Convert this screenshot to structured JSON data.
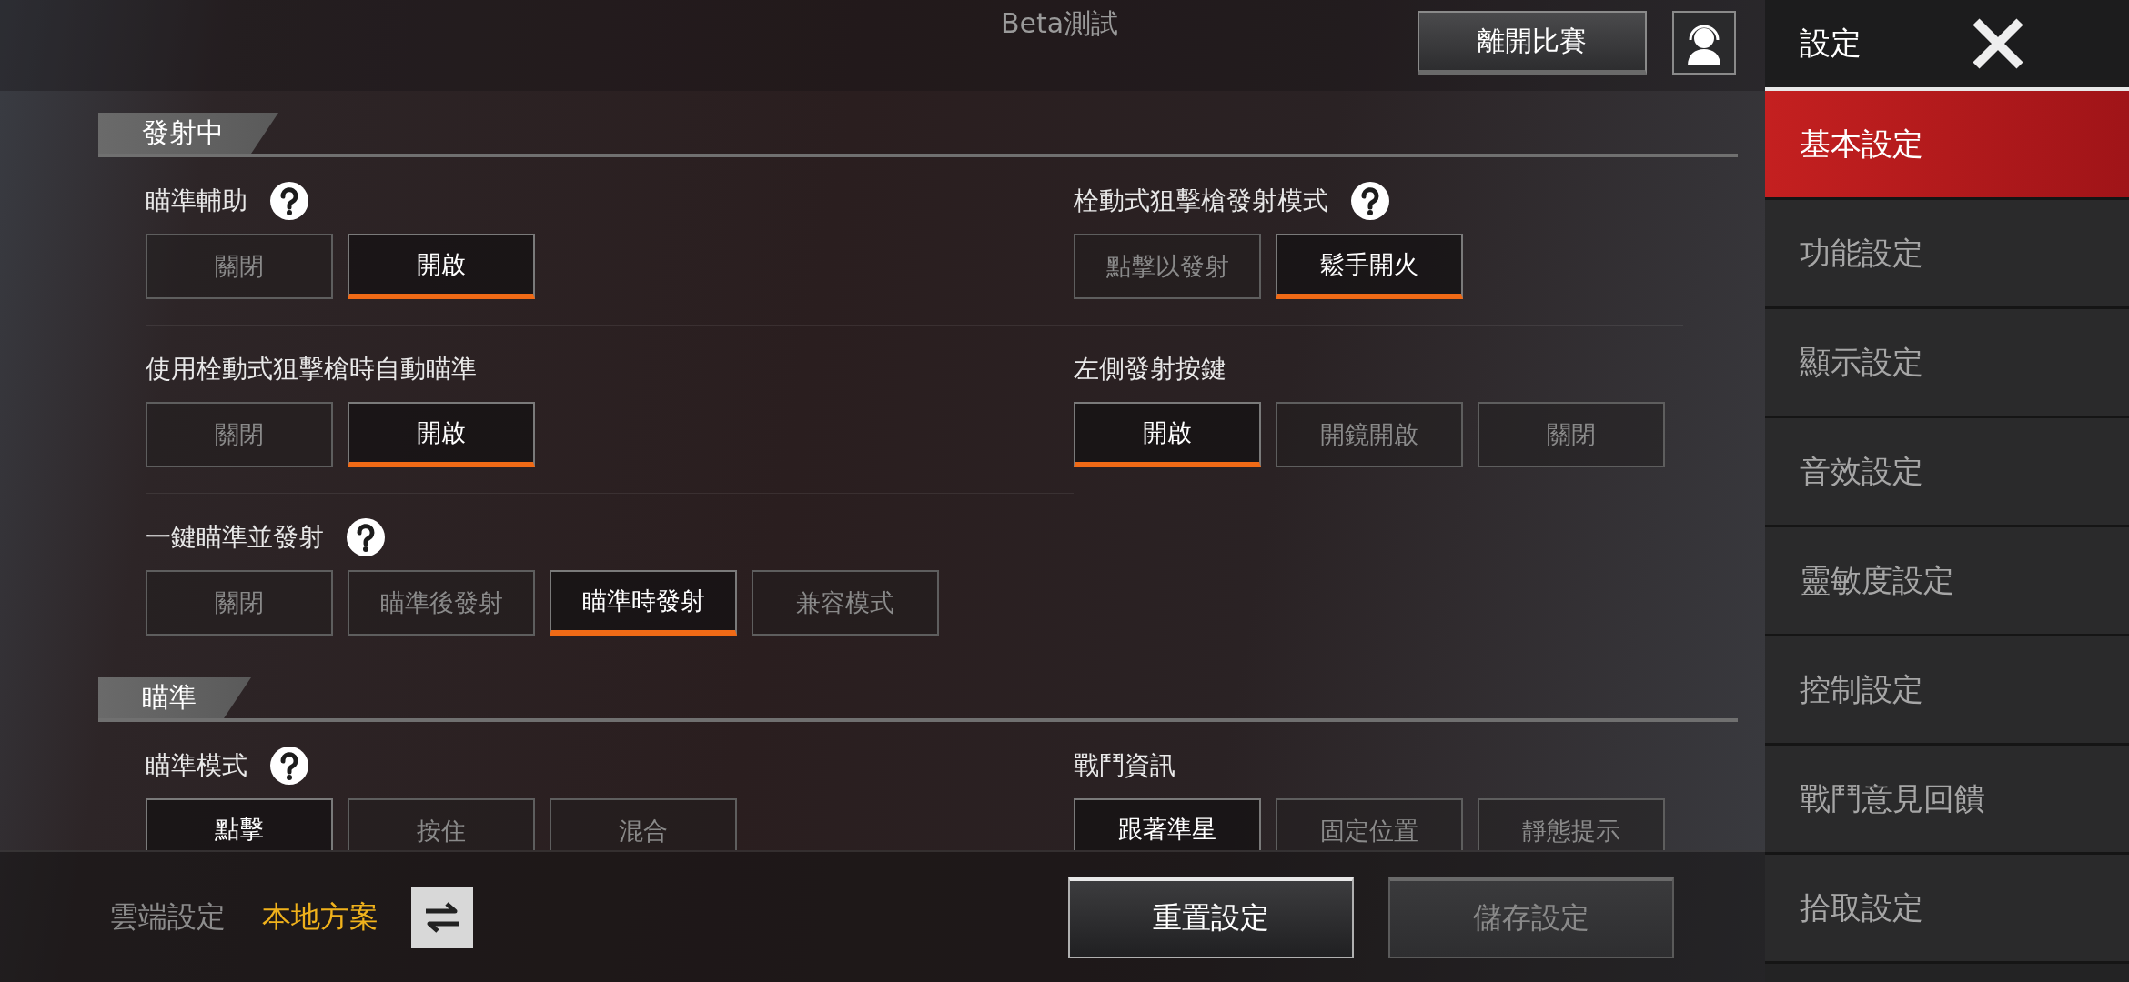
{
  "top_bar": {
    "title": "Beta測試",
    "leave_button": "離開比賽"
  },
  "sections": [
    {
      "title": "發射中",
      "settings": [
        {
          "label": "瞄準輔助",
          "help": true,
          "options": [
            {
              "label": "關閉",
              "selected": false
            },
            {
              "label": "開啟",
              "selected": true
            }
          ]
        },
        {
          "label": "栓動式狙擊槍發射模式",
          "help": true,
          "options": [
            {
              "label": "點擊以發射",
              "selected": false
            },
            {
              "label": "鬆手開火",
              "selected": true
            }
          ]
        },
        {
          "label": "使用栓動式狙擊槍時自動瞄準",
          "help": false,
          "options": [
            {
              "label": "關閉",
              "selected": false
            },
            {
              "label": "開啟",
              "selected": true
            }
          ]
        },
        {
          "label": "左側發射按鍵",
          "help": false,
          "options": [
            {
              "label": "開啟",
              "selected": true
            },
            {
              "label": "開鏡開啟",
              "selected": false
            },
            {
              "label": "關閉",
              "selected": false
            }
          ]
        },
        {
          "label": "一鍵瞄準並發射",
          "help": true,
          "options": [
            {
              "label": "關閉",
              "selected": false
            },
            {
              "label": "瞄準後發射",
              "selected": false
            },
            {
              "label": "瞄準時發射",
              "selected": true
            },
            {
              "label": "兼容模式",
              "selected": false
            }
          ]
        }
      ]
    },
    {
      "title": "瞄準",
      "settings": [
        {
          "label": "瞄準模式",
          "help": true,
          "options": [
            {
              "label": "點擊",
              "selected": true
            },
            {
              "label": "按住",
              "selected": false
            },
            {
              "label": "混合",
              "selected": false
            }
          ]
        },
        {
          "label": "戰鬥資訊",
          "help": false,
          "options": [
            {
              "label": "跟著準星",
              "selected": true
            },
            {
              "label": "固定位置",
              "selected": false
            },
            {
              "label": "靜態提示",
              "selected": false
            }
          ]
        }
      ]
    }
  ],
  "bottom_bar": {
    "profiles": [
      {
        "label": "雲端設定",
        "selected": false
      },
      {
        "label": "本地方案",
        "selected": true
      }
    ],
    "buttons": [
      {
        "label": "重置設定",
        "disabled": false
      },
      {
        "label": "儲存設定",
        "disabled": true
      }
    ]
  },
  "sidebar": {
    "title": "設定",
    "items": [
      {
        "label": "基本設定",
        "selected": true
      },
      {
        "label": "功能設定",
        "selected": false
      },
      {
        "label": "顯示設定",
        "selected": false
      },
      {
        "label": "音效設定",
        "selected": false
      },
      {
        "label": "靈敏度設定",
        "selected": false
      },
      {
        "label": "控制設定",
        "selected": false
      },
      {
        "label": "戰鬥意見回饋",
        "selected": false
      },
      {
        "label": "拾取設定",
        "selected": false
      }
    ]
  }
}
